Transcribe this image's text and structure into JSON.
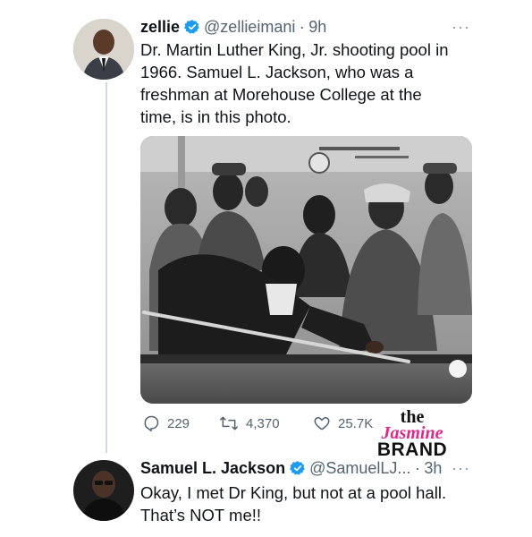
{
  "tweet1": {
    "name": "zellie",
    "handle": "@zellieimani",
    "separator": "·",
    "time": "9h",
    "more": "···",
    "text_lines": [
      "Dr. Martin Luther King, Jr. shooting pool in",
      "1966. Samuel L. Jackson, who was a",
      "freshman at Morehouse College at the",
      "time, is in this photo."
    ],
    "actions": {
      "replies": "229",
      "retweets": "4,370",
      "likes": "25.7K"
    }
  },
  "watermark": {
    "line1": "the",
    "line2": "Jasmine",
    "line3": "BRAND"
  },
  "tweet2": {
    "name": "Samuel L. Jackson",
    "handle": "@SamuelLJ...",
    "separator": "·",
    "time": "3h",
    "more": "···",
    "text_lines": [
      "Okay, I met Dr King, but not at a pool hall.",
      "That’s NOT me!!"
    ]
  },
  "colors": {
    "verified_blue": "#1d9bf0",
    "secondary_text": "#536471",
    "watermark_pink": "#e0278a"
  },
  "icons": [
    "verified-badge-icon",
    "reply-icon",
    "retweet-icon",
    "like-icon",
    "more-icon"
  ]
}
